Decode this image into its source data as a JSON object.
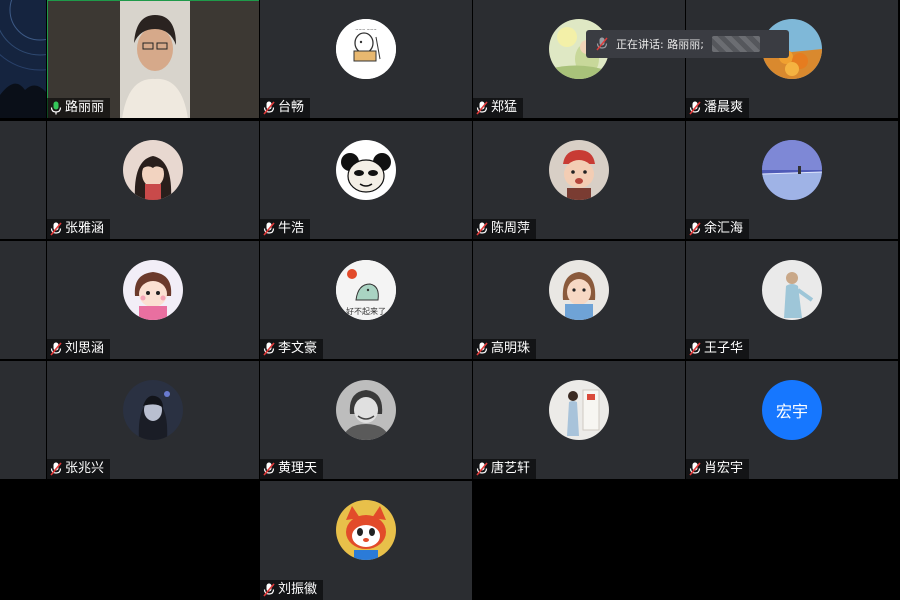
{
  "speaking_toast": {
    "label": "正在讲话: 路丽丽;",
    "icon": "mic-muted-icon"
  },
  "colors": {
    "tile_bg": "#2b2d31",
    "speaker_border": "#1f9a4a",
    "avatar_blue": "#1677ff",
    "mic_active": "#34c759",
    "mic_muted": "#e03a3a"
  },
  "participants": [
    {
      "name": "路丽丽",
      "mic": "active",
      "video": true
    },
    {
      "name": "台畅",
      "mic": "muted"
    },
    {
      "name": "郑猛",
      "mic": "muted"
    },
    {
      "name": "潘晨爽",
      "mic": "muted"
    },
    {
      "name": "张雅涵",
      "mic": "muted"
    },
    {
      "name": "牛浩",
      "mic": "muted"
    },
    {
      "name": "陈周萍",
      "mic": "muted"
    },
    {
      "name": "余汇海",
      "mic": "muted"
    },
    {
      "name": "刘思涵",
      "mic": "muted"
    },
    {
      "name": "李文豪",
      "mic": "muted",
      "avatar_text": "好不起来了"
    },
    {
      "name": "高明珠",
      "mic": "muted"
    },
    {
      "name": "王子华",
      "mic": "muted"
    },
    {
      "name": "张兆兴",
      "mic": "muted"
    },
    {
      "name": "黄理天",
      "mic": "muted"
    },
    {
      "name": "唐艺轩",
      "mic": "muted"
    },
    {
      "name": "肖宏宇",
      "mic": "muted",
      "avatar_text": "宏宇"
    },
    {
      "name": "刘振徽",
      "mic": "muted"
    }
  ]
}
